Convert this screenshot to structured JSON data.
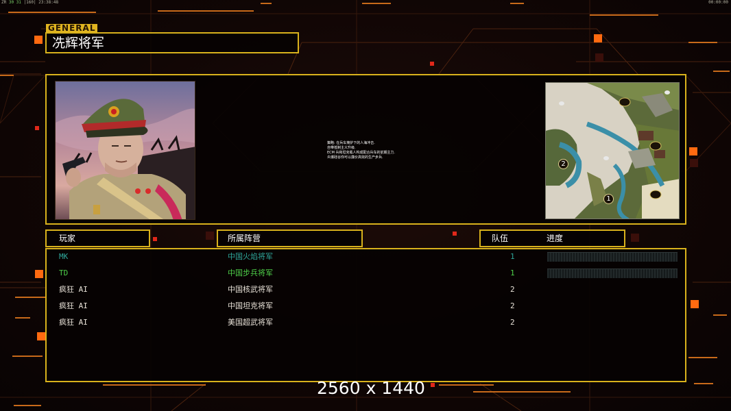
{
  "system_bar": {
    "left_prefix": "ZR",
    "left_fps": "30 31",
    "left_info": "|160| 23:38:48",
    "right_time": "00:00:00"
  },
  "general": {
    "tag": "GENERAL",
    "name": "冼辉将军"
  },
  "description": {
    "lines": [
      "策略: 在兵车掩护下的人海冲击.",
      "自带抵制主义升级.",
      "ECM 兵和坦克载人构成配合兵车的前期主力.",
      "炎爆硅谷你可以廉价高效的生产步兵."
    ]
  },
  "minimap": {
    "start_markers": [
      "1",
      "2"
    ]
  },
  "table": {
    "headers": {
      "player": "玩家",
      "faction": "所属阵营",
      "team": "队伍",
      "progress": "进度"
    },
    "rows": [
      {
        "name": "MK",
        "faction": "中国火焰将军",
        "team": "1",
        "progress": 0.0,
        "color": "#2ea69a",
        "show_bar": true
      },
      {
        "name": "TD",
        "faction": "中国步兵将军",
        "team": "1",
        "progress": 0.0,
        "color": "#4fd14a",
        "show_bar": true
      },
      {
        "name": "疯狂 AI",
        "faction": "中国核武将军",
        "team": "2",
        "progress": null,
        "color": "#e8e2d8",
        "show_bar": false
      },
      {
        "name": "疯狂 AI",
        "faction": "中国坦克将军",
        "team": "2",
        "progress": null,
        "color": "#e8e2d8",
        "show_bar": false
      },
      {
        "name": "疯狂 AI",
        "faction": "美国超武将军",
        "team": "2",
        "progress": null,
        "color": "#e8e2d8",
        "show_bar": false
      }
    ]
  },
  "watermark": "2560 x 1440",
  "colors": {
    "frame": "#d9b21c",
    "accent_orange": "#ff6a10",
    "background": "#0c0504"
  }
}
